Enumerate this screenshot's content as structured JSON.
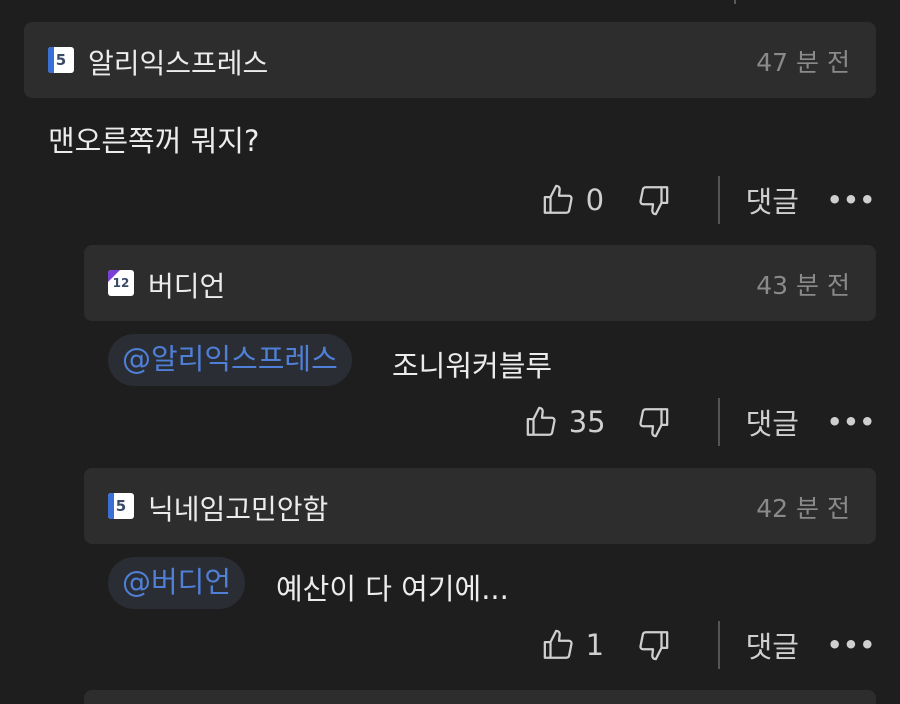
{
  "comments": [
    {
      "badge": "5",
      "username": "알리익스프레스",
      "time": "47 분 전",
      "mention": "",
      "text": "맨오른쪽꺼 뭐지?",
      "likes": "0",
      "reply_label": "댓글"
    },
    {
      "badge": "12",
      "username": "버디언",
      "time": "43 분 전",
      "mention": "@알리익스프레스",
      "text": "조니워커블루",
      "likes": "35",
      "reply_label": "댓글"
    },
    {
      "badge": "5",
      "username": "닉네임고민안함",
      "time": "42 분 전",
      "mention": "@버디언",
      "text": "예산이 다 여기에...",
      "likes": "1",
      "reply_label": "댓글"
    }
  ],
  "more_icon": "•••",
  "colors": {
    "background": "#1e1e1e",
    "header": "#2d2d2d",
    "mention": "#4f7fd6",
    "mention_bg": "#2a2d33",
    "time": "#8a8a8a"
  }
}
